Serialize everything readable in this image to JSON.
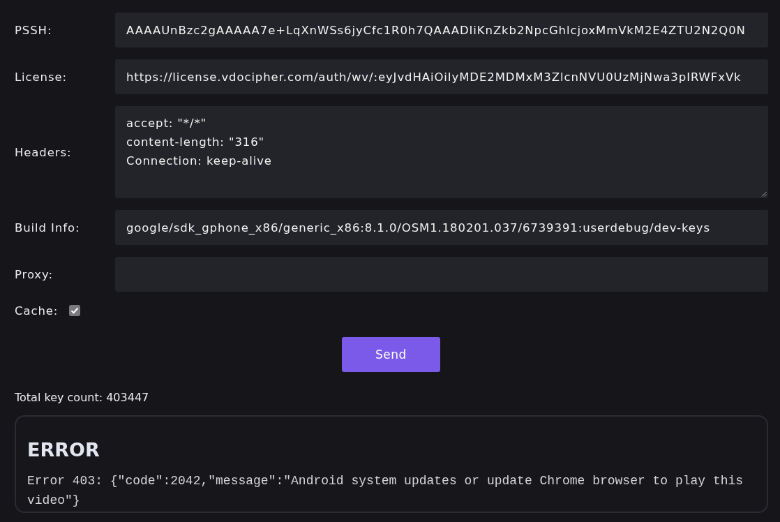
{
  "fields": [
    {
      "kind": "input",
      "label": "PSSH:",
      "value": "AAAAUnBzc2gAAAAA7e+LqXnWSs6jyCfc1R0h7QAAADIiKnZkb2NpcGhlcjoxMmVkM2E4ZTU2N2Q0N"
    },
    {
      "kind": "input",
      "label": "License:",
      "value": "https://license.vdocipher.com/auth/wv/:eyJvdHAiOiIyMDE2MDMxM3ZlcnNVU0UzMjNwa3pIRWFxVk"
    },
    {
      "kind": "textarea",
      "label": "Headers:",
      "value": "accept: \"*/*\"\ncontent-length: \"316\"\nConnection: keep-alive"
    },
    {
      "kind": "input",
      "label": "Build Info:",
      "value": "google/sdk_gphone_x86/generic_x86:8.1.0/OSM1.180201.037/6739391:userdebug/dev-keys"
    },
    {
      "kind": "input",
      "label": "Proxy:"
    }
  ],
  "cache": {
    "label": "Cache:",
    "checked": true
  },
  "send_button": {
    "label": "Send"
  },
  "key_count": "Total key count: 403447",
  "error": {
    "title": "ERROR",
    "message": "Error 403: {\"code\":2042,\"message\":\"Android system updates or update Chrome browser to play this video\"}"
  }
}
